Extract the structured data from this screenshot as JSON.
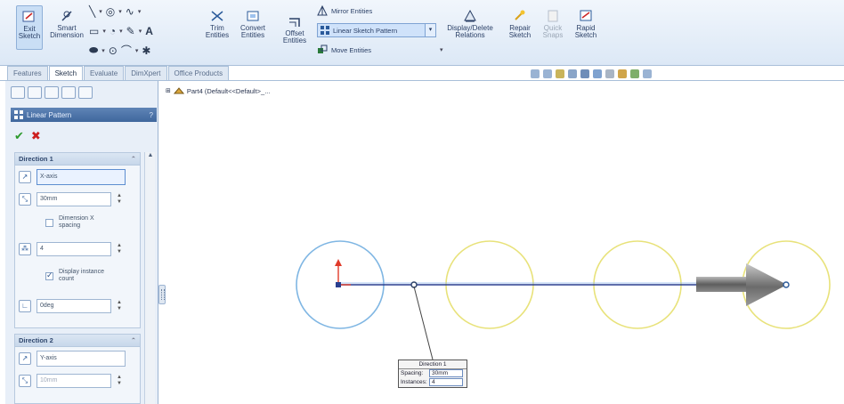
{
  "ribbon": {
    "exit_sketch": "Exit\nSketch",
    "smart_dimension": "Smart\nDimension",
    "trim_entities": "Trim\nEntities",
    "convert_entities": "Convert\nEntities",
    "offset_entities": "Offset\nEntities",
    "mirror_entities": "Mirror Entities",
    "linear_sketch_pattern": "Linear Sketch Pattern",
    "move_entities": "Move Entities",
    "display_delete_relations": "Display/Delete\nRelations",
    "repair_sketch": "Repair\nSketch",
    "quick_snaps": "Quick\nSnaps",
    "rapid_sketch": "Rapid\nSketch"
  },
  "tabs": [
    "Features",
    "Sketch",
    "Evaluate",
    "DimXpert",
    "Office Products"
  ],
  "active_tab": "Sketch",
  "tree": {
    "part_label": "Part4 (Default<<Default>_..."
  },
  "property_manager": {
    "title": "Linear Pattern",
    "help": "?",
    "direction1": {
      "header": "Direction 1",
      "axis": "X-axis",
      "spacing": "30mm",
      "dimension_x_spacing": "Dimension X spacing",
      "instances": "4",
      "display_instance_count": "Display instance count",
      "angle": "0deg"
    },
    "direction2": {
      "header": "Direction 2",
      "axis": "Y-axis",
      "spacing": "10mm"
    }
  },
  "callout": {
    "title": "Direction 1",
    "spacing_label": "Spacing:",
    "spacing_value": "30mm",
    "instances_label": "Instances:",
    "instances_value": "4"
  },
  "colors": {
    "source_circle": "#7fb6e3",
    "preview_circle": "#e8e27a",
    "direction_line": "#2a3f8f",
    "arrow": "#6f6f6f"
  }
}
